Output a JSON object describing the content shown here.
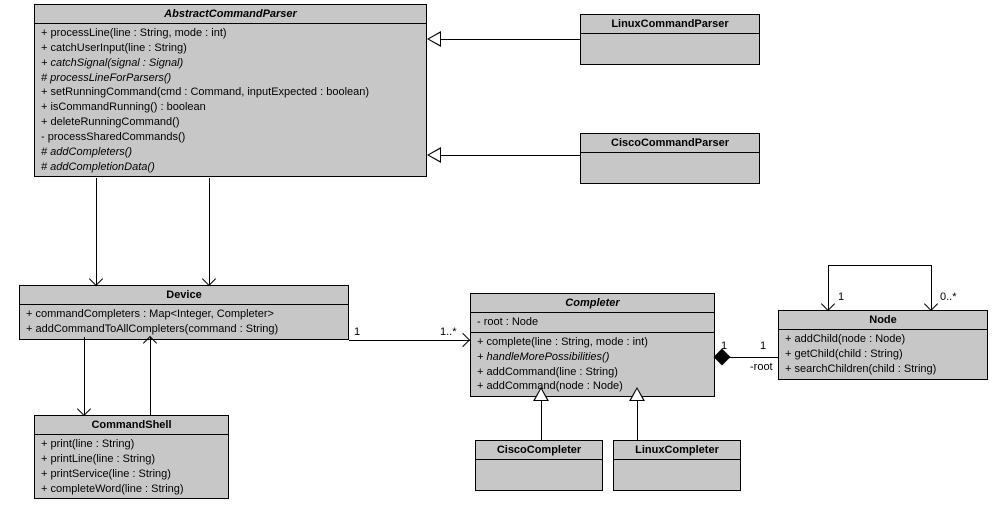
{
  "diagram_type": "uml_class_diagram",
  "classes": {
    "AbstractCommandParser": {
      "name": "AbstractCommandParser",
      "abstract": true,
      "members": [
        "+ processLine(line : String, mode : int)",
        "+ catchUserInput(line : String)",
        "+ catchSignal(signal : Signal)",
        "# processLineForParsers()",
        "+ setRunningCommand(cmd : Command, inputExpected : boolean)",
        "+ isCommandRunning() : boolean",
        "+ deleteRunningCommand()",
        "- processSharedCommands()",
        "# addCompleters()",
        "# addCompletionData()"
      ],
      "abstract_members": [
        2,
        3,
        8,
        9
      ]
    },
    "LinuxCommandParser": {
      "name": "LinuxCommandParser",
      "members": []
    },
    "CiscoCommandParser": {
      "name": "CiscoCommandParser",
      "members": []
    },
    "Device": {
      "name": "Device",
      "members": [
        "+ commandCompleters : Map<Integer, Completer>",
        "+ addCommandToAllCompleters(command : String)"
      ]
    },
    "CommandShell": {
      "name": "CommandShell",
      "members": [
        "+ print(line : String)",
        "+ printLine(line : String)",
        "+ printService(line : String)",
        "+ completeWord(line : String)"
      ]
    },
    "Completer": {
      "name": "Completer",
      "abstract": true,
      "attrs": [
        "- root : Node"
      ],
      "members": [
        "+ complete(line : String, mode : int)",
        "+ handleMorePossibilities()",
        "+ addCommand(line : String)",
        "+ addCommand(node : Node)"
      ],
      "abstract_members": [
        1
      ]
    },
    "CiscoCompleter": {
      "name": "CiscoCompleter",
      "members": []
    },
    "LinuxCompleter": {
      "name": "LinuxCompleter",
      "members": []
    },
    "Node": {
      "name": "Node",
      "members": [
        "+ addChild(node : Node)",
        "+ getChild(child : String)",
        "+ searchChildren(child : String)"
      ]
    }
  },
  "relations": {
    "linux_parser_inherits": {
      "from": "LinuxCommandParser",
      "to": "AbstractCommandParser",
      "type": "generalization"
    },
    "cisco_parser_inherits": {
      "from": "CiscoCommandParser",
      "to": "AbstractCommandParser",
      "type": "generalization"
    },
    "cisco_completer_inherits": {
      "from": "CiscoCompleter",
      "to": "Completer",
      "type": "generalization"
    },
    "linux_completer_inherits": {
      "from": "LinuxCompleter",
      "to": "Completer",
      "type": "generalization"
    },
    "parser_to_device": {
      "from": "AbstractCommandParser",
      "to": "Device",
      "type": "association_directed"
    },
    "device_to_shell_bidir": {
      "a": "Device",
      "b": "CommandShell",
      "type": "association_bidirectional"
    },
    "device_to_completer": {
      "from": "Device",
      "to": "Completer",
      "type": "association_directed",
      "mult_from": "1",
      "mult_to": "1..*"
    },
    "completer_to_node": {
      "from": "Completer",
      "to": "Node",
      "type": "composition",
      "mult_from": "1",
      "mult_to": "1",
      "role": "-root"
    },
    "node_self": {
      "on": "Node",
      "type": "association_self",
      "mult_parent": "1",
      "mult_child": "0..*"
    }
  },
  "labels": {
    "dev_comp_1": "1",
    "dev_comp_many": "1..*",
    "comp_node_left": "1",
    "comp_node_right": "1",
    "comp_node_role": "-root",
    "node_self_1": "1",
    "node_self_many": "0..*"
  }
}
